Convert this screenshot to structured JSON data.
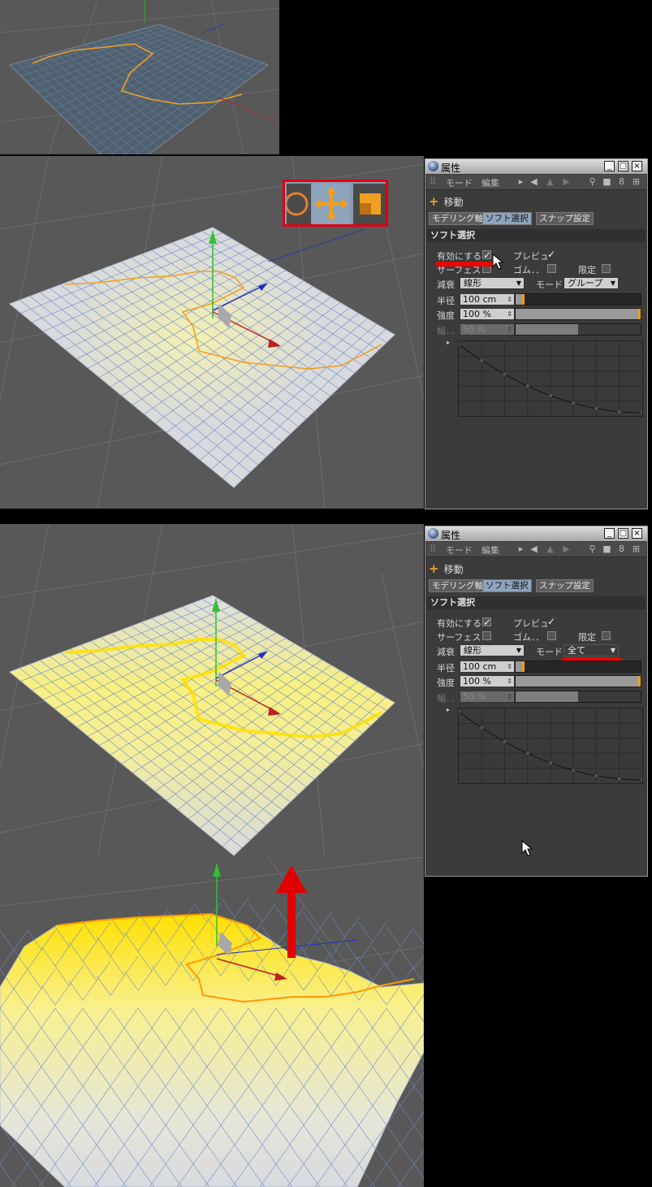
{
  "panel": {
    "title": "属性",
    "menu_mode": "モード",
    "menu_edit": "編集",
    "object": "移動",
    "tabs": [
      "モデリング軸",
      "ソフト選択",
      "スナップ設定"
    ],
    "section": "ソフト選択",
    "enable_label": "有効にする",
    "preview_label": "プレビュ",
    "surface_label": "サーフェス",
    "rubber_label": "ゴム．．",
    "limit_label": "限定",
    "falloff_label": "減衰",
    "falloff_value": "線形",
    "mode_label": "モード",
    "mode_value_1": "グループ",
    "mode_value_2": "全て",
    "radius_label": "半径",
    "radius_value": "100 cm",
    "strength_label": "強度",
    "strength_value": "100 %",
    "width_label": "幅．．",
    "width_value": "50 %",
    "radius_level": 0.07,
    "strength_level": 1.0,
    "width_level": 0.5
  },
  "colors": {
    "selection": "#f0a020",
    "annotation": "#e00000",
    "active_tab": "#8ea3bc"
  }
}
